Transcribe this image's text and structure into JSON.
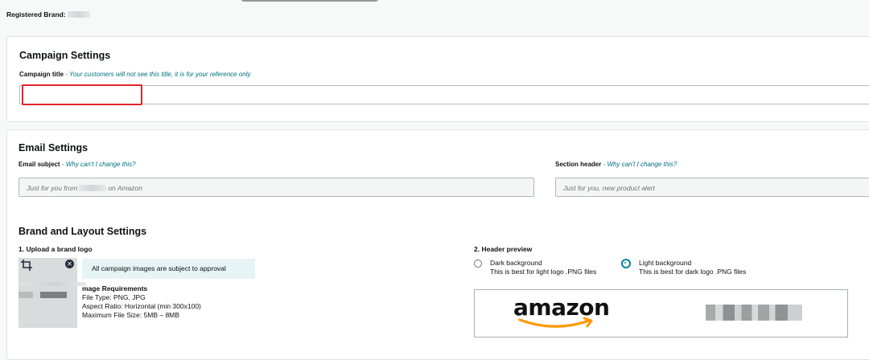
{
  "brand": {
    "label": "Registered Brand:"
  },
  "campaign_settings": {
    "title": "Campaign Settings",
    "campaign_title_label": "Campaign title",
    "campaign_title_hint": " - Your customers will not see this title, it is for your reference only",
    "campaign_title_value": ""
  },
  "email_settings": {
    "title": "Email Settings",
    "subject_label": "Email subject",
    "subject_hint": " - Why can't I change this?",
    "subject_value_prefix": "Just for you from",
    "subject_value_suffix": "on Amazon",
    "section_header_label": "Section header",
    "section_header_hint": " - Why can't I change this?",
    "section_header_value": "Just for you, new product alert"
  },
  "brand_layout": {
    "title": "Brand and Layout Settings",
    "upload_label": "1. Upload a brand logo",
    "approval_notice": "All campaign images are subject to approval",
    "requirements": {
      "title": "mage Requirements",
      "file_type": "File Type: PNG, JPG",
      "aspect_ratio": "Aspect Ratio: Horizontal (min 300x100)",
      "max_size": "Maximum File Size: 5MB – 8MB"
    },
    "header_preview_label": "2. Header preview",
    "dark_option": {
      "label": "Dark background",
      "note": "This is best for light logo .PNG files",
      "selected": false
    },
    "light_option": {
      "label": "Light background",
      "note": "This is best for dark logo .PNG files",
      "selected": true
    },
    "preview_logo_text": "amazon"
  },
  "colors": {
    "accent": "#007185",
    "highlight": "#e0262a",
    "notice_bg": "#e7f4f5"
  },
  "icons": {
    "crop": "crop-icon",
    "remove": "close-icon",
    "smile": "amazon-smile-icon"
  }
}
